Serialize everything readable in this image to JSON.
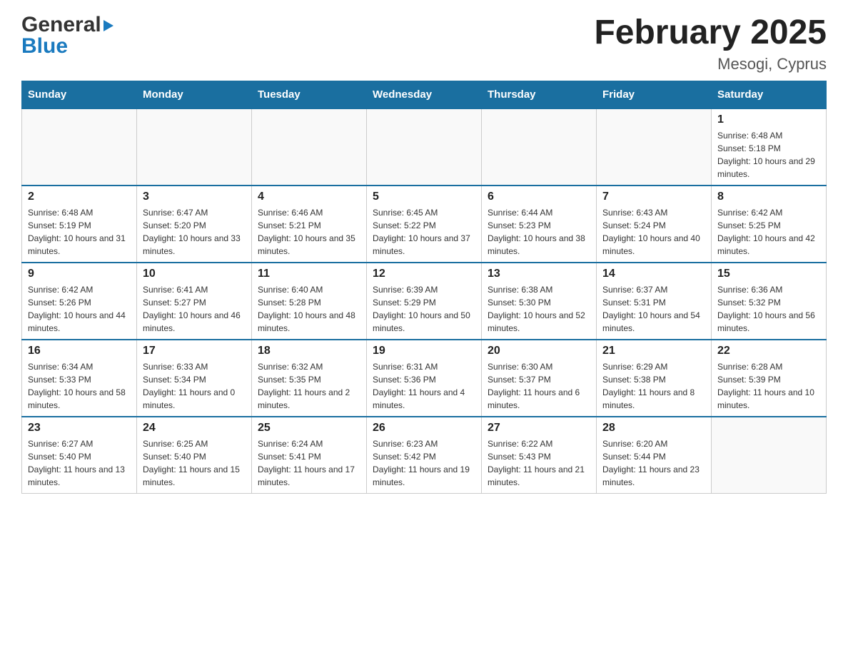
{
  "logo": {
    "line1": "General",
    "line2": "Blue"
  },
  "header": {
    "title": "February 2025",
    "location": "Mesogi, Cyprus"
  },
  "days_of_week": [
    "Sunday",
    "Monday",
    "Tuesday",
    "Wednesday",
    "Thursday",
    "Friday",
    "Saturday"
  ],
  "weeks": [
    {
      "days": [
        {
          "number": "",
          "info": ""
        },
        {
          "number": "",
          "info": ""
        },
        {
          "number": "",
          "info": ""
        },
        {
          "number": "",
          "info": ""
        },
        {
          "number": "",
          "info": ""
        },
        {
          "number": "",
          "info": ""
        },
        {
          "number": "1",
          "info": "Sunrise: 6:48 AM\nSunset: 5:18 PM\nDaylight: 10 hours and 29 minutes."
        }
      ]
    },
    {
      "days": [
        {
          "number": "2",
          "info": "Sunrise: 6:48 AM\nSunset: 5:19 PM\nDaylight: 10 hours and 31 minutes."
        },
        {
          "number": "3",
          "info": "Sunrise: 6:47 AM\nSunset: 5:20 PM\nDaylight: 10 hours and 33 minutes."
        },
        {
          "number": "4",
          "info": "Sunrise: 6:46 AM\nSunset: 5:21 PM\nDaylight: 10 hours and 35 minutes."
        },
        {
          "number": "5",
          "info": "Sunrise: 6:45 AM\nSunset: 5:22 PM\nDaylight: 10 hours and 37 minutes."
        },
        {
          "number": "6",
          "info": "Sunrise: 6:44 AM\nSunset: 5:23 PM\nDaylight: 10 hours and 38 minutes."
        },
        {
          "number": "7",
          "info": "Sunrise: 6:43 AM\nSunset: 5:24 PM\nDaylight: 10 hours and 40 minutes."
        },
        {
          "number": "8",
          "info": "Sunrise: 6:42 AM\nSunset: 5:25 PM\nDaylight: 10 hours and 42 minutes."
        }
      ]
    },
    {
      "days": [
        {
          "number": "9",
          "info": "Sunrise: 6:42 AM\nSunset: 5:26 PM\nDaylight: 10 hours and 44 minutes."
        },
        {
          "number": "10",
          "info": "Sunrise: 6:41 AM\nSunset: 5:27 PM\nDaylight: 10 hours and 46 minutes."
        },
        {
          "number": "11",
          "info": "Sunrise: 6:40 AM\nSunset: 5:28 PM\nDaylight: 10 hours and 48 minutes."
        },
        {
          "number": "12",
          "info": "Sunrise: 6:39 AM\nSunset: 5:29 PM\nDaylight: 10 hours and 50 minutes."
        },
        {
          "number": "13",
          "info": "Sunrise: 6:38 AM\nSunset: 5:30 PM\nDaylight: 10 hours and 52 minutes."
        },
        {
          "number": "14",
          "info": "Sunrise: 6:37 AM\nSunset: 5:31 PM\nDaylight: 10 hours and 54 minutes."
        },
        {
          "number": "15",
          "info": "Sunrise: 6:36 AM\nSunset: 5:32 PM\nDaylight: 10 hours and 56 minutes."
        }
      ]
    },
    {
      "days": [
        {
          "number": "16",
          "info": "Sunrise: 6:34 AM\nSunset: 5:33 PM\nDaylight: 10 hours and 58 minutes."
        },
        {
          "number": "17",
          "info": "Sunrise: 6:33 AM\nSunset: 5:34 PM\nDaylight: 11 hours and 0 minutes."
        },
        {
          "number": "18",
          "info": "Sunrise: 6:32 AM\nSunset: 5:35 PM\nDaylight: 11 hours and 2 minutes."
        },
        {
          "number": "19",
          "info": "Sunrise: 6:31 AM\nSunset: 5:36 PM\nDaylight: 11 hours and 4 minutes."
        },
        {
          "number": "20",
          "info": "Sunrise: 6:30 AM\nSunset: 5:37 PM\nDaylight: 11 hours and 6 minutes."
        },
        {
          "number": "21",
          "info": "Sunrise: 6:29 AM\nSunset: 5:38 PM\nDaylight: 11 hours and 8 minutes."
        },
        {
          "number": "22",
          "info": "Sunrise: 6:28 AM\nSunset: 5:39 PM\nDaylight: 11 hours and 10 minutes."
        }
      ]
    },
    {
      "days": [
        {
          "number": "23",
          "info": "Sunrise: 6:27 AM\nSunset: 5:40 PM\nDaylight: 11 hours and 13 minutes."
        },
        {
          "number": "24",
          "info": "Sunrise: 6:25 AM\nSunset: 5:40 PM\nDaylight: 11 hours and 15 minutes."
        },
        {
          "number": "25",
          "info": "Sunrise: 6:24 AM\nSunset: 5:41 PM\nDaylight: 11 hours and 17 minutes."
        },
        {
          "number": "26",
          "info": "Sunrise: 6:23 AM\nSunset: 5:42 PM\nDaylight: 11 hours and 19 minutes."
        },
        {
          "number": "27",
          "info": "Sunrise: 6:22 AM\nSunset: 5:43 PM\nDaylight: 11 hours and 21 minutes."
        },
        {
          "number": "28",
          "info": "Sunrise: 6:20 AM\nSunset: 5:44 PM\nDaylight: 11 hours and 23 minutes."
        },
        {
          "number": "",
          "info": ""
        }
      ]
    }
  ]
}
